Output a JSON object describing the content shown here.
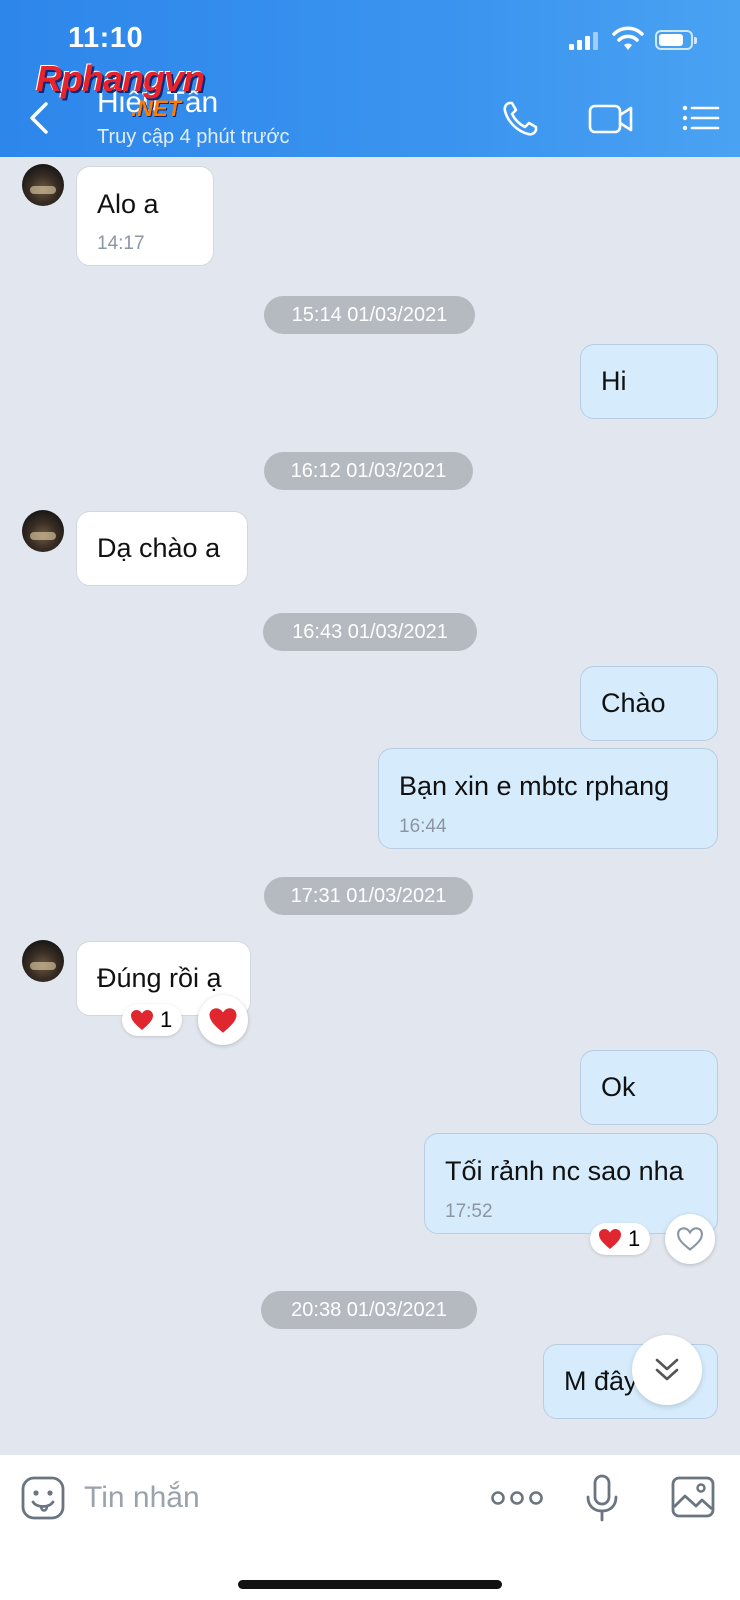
{
  "status_bar": {
    "time": "11:10"
  },
  "header": {
    "contact_name": "Hiếu Tấn",
    "status": "Truy cập 4 phút trước",
    "watermark": {
      "main": "Rphangvn",
      "sub": ".NET"
    }
  },
  "messages": [
    {
      "kind": "in",
      "text": "Alo a",
      "time": "14:17"
    },
    {
      "kind": "date",
      "text": "15:14 01/03/2021"
    },
    {
      "kind": "out",
      "text": "Hi"
    },
    {
      "kind": "date",
      "text": "16:12 01/03/2021"
    },
    {
      "kind": "in",
      "text": "Dạ chào a"
    },
    {
      "kind": "date",
      "text": "16:43 01/03/2021"
    },
    {
      "kind": "out",
      "text": "Chào"
    },
    {
      "kind": "out",
      "text": "Bạn xin e mbtc rphang",
      "time": "16:44"
    },
    {
      "kind": "date",
      "text": "17:31 01/03/2021"
    },
    {
      "kind": "in",
      "text": "Đúng rồi ạ",
      "reaction_count": "1"
    },
    {
      "kind": "out",
      "text": "Ok"
    },
    {
      "kind": "out",
      "text": "Tối rảnh nc sao nha",
      "time": "17:52",
      "reaction_count": "1"
    },
    {
      "kind": "date",
      "text": "20:38 01/03/2021"
    },
    {
      "kind": "out",
      "text": "M đây bác"
    }
  ],
  "composer": {
    "placeholder": "Tin nhắn"
  },
  "colors": {
    "header": "#3a94ef",
    "chat_bg": "#e2e6ee",
    "out_bubble": "#d6ecfc",
    "in_bubble": "#ffffff",
    "date_pill": "#b5b9c0",
    "heart": "#e0262e"
  }
}
